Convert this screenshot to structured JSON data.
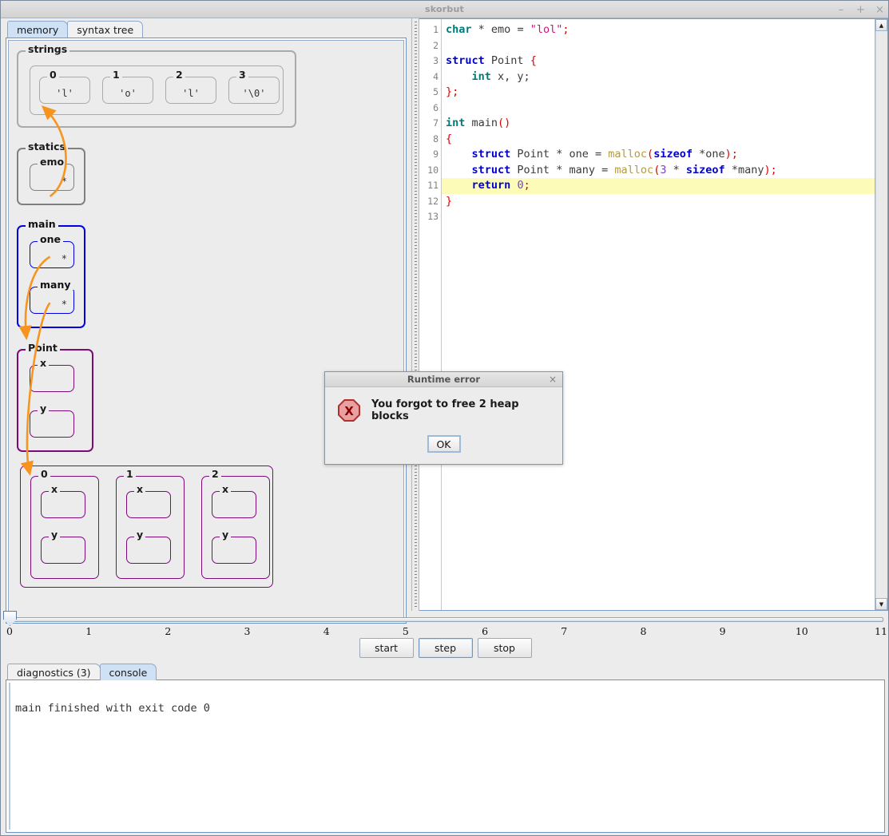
{
  "window": {
    "title": "skorbut",
    "controls": [
      {
        "name": "minimize",
        "glyph": "–"
      },
      {
        "name": "maximize",
        "glyph": "+"
      },
      {
        "name": "close",
        "glyph": "×"
      }
    ]
  },
  "left_tabs": [
    {
      "label": "memory",
      "selected": true
    },
    {
      "label": "syntax tree",
      "selected": false
    }
  ],
  "memory": {
    "strings": {
      "label": "strings",
      "block_label": "",
      "cells": [
        {
          "index": "0",
          "value": "'l'"
        },
        {
          "index": "1",
          "value": "'o'"
        },
        {
          "index": "2",
          "value": "'l'"
        },
        {
          "index": "3",
          "value": "'\\0'"
        }
      ]
    },
    "statics": {
      "label": "statics",
      "vars": [
        {
          "name": "emo",
          "value": "*"
        }
      ]
    },
    "main": {
      "label": "main",
      "vars": [
        {
          "name": "one",
          "value": "*"
        },
        {
          "name": "many",
          "value": "*"
        }
      ]
    },
    "point": {
      "label": "Point",
      "fields": [
        {
          "name": "x",
          "value": ""
        },
        {
          "name": "y",
          "value": ""
        }
      ]
    },
    "heap_array": {
      "elements": [
        {
          "index": "0",
          "fields": [
            {
              "name": "x",
              "value": ""
            },
            {
              "name": "y",
              "value": ""
            }
          ]
        },
        {
          "index": "1",
          "fields": [
            {
              "name": "x",
              "value": ""
            },
            {
              "name": "y",
              "value": ""
            }
          ]
        },
        {
          "index": "2",
          "fields": [
            {
              "name": "x",
              "value": ""
            },
            {
              "name": "y",
              "value": ""
            }
          ]
        }
      ]
    },
    "pointer_color": "#F7941E"
  },
  "editor": {
    "highlighted_line": 11,
    "lines": [
      {
        "n": 1,
        "tokens": [
          {
            "t": "char",
            "c": "ty"
          },
          {
            "t": " ",
            "c": "op"
          },
          {
            "t": "*",
            "c": "op"
          },
          {
            "t": " emo ",
            "c": "id"
          },
          {
            "t": "=",
            "c": "op"
          },
          {
            "t": " ",
            "c": "id"
          },
          {
            "t": "\"lol\"",
            "c": "str"
          },
          {
            "t": ";",
            "c": "punc"
          }
        ]
      },
      {
        "n": 2,
        "tokens": []
      },
      {
        "n": 3,
        "tokens": [
          {
            "t": "struct",
            "c": "k"
          },
          {
            "t": " Point ",
            "c": "id"
          },
          {
            "t": "{",
            "c": "punc"
          }
        ]
      },
      {
        "n": 4,
        "tokens": [
          {
            "t": "    ",
            "c": "id"
          },
          {
            "t": "int",
            "c": "ty"
          },
          {
            "t": " x, y;",
            "c": "id"
          }
        ]
      },
      {
        "n": 5,
        "tokens": [
          {
            "t": "}",
            "c": "punc"
          },
          {
            "t": ";",
            "c": "punc"
          }
        ]
      },
      {
        "n": 6,
        "tokens": []
      },
      {
        "n": 7,
        "tokens": [
          {
            "t": "int",
            "c": "ty"
          },
          {
            "t": " main",
            "c": "id"
          },
          {
            "t": "()",
            "c": "punc"
          }
        ]
      },
      {
        "n": 8,
        "tokens": [
          {
            "t": "{",
            "c": "punc"
          }
        ]
      },
      {
        "n": 9,
        "tokens": [
          {
            "t": "    ",
            "c": "id"
          },
          {
            "t": "struct",
            "c": "k"
          },
          {
            "t": " Point ",
            "c": "id"
          },
          {
            "t": "*",
            "c": "op"
          },
          {
            "t": " one ",
            "c": "id"
          },
          {
            "t": "=",
            "c": "op"
          },
          {
            "t": " ",
            "c": "id"
          },
          {
            "t": "malloc",
            "c": "fn"
          },
          {
            "t": "(",
            "c": "punc"
          },
          {
            "t": "sizeof",
            "c": "k"
          },
          {
            "t": " ",
            "c": "id"
          },
          {
            "t": "*",
            "c": "op"
          },
          {
            "t": "one",
            "c": "id"
          },
          {
            "t": ")",
            "c": "punc"
          },
          {
            "t": ";",
            "c": "punc"
          }
        ]
      },
      {
        "n": 10,
        "tokens": [
          {
            "t": "    ",
            "c": "id"
          },
          {
            "t": "struct",
            "c": "k"
          },
          {
            "t": " Point ",
            "c": "id"
          },
          {
            "t": "*",
            "c": "op"
          },
          {
            "t": " many ",
            "c": "id"
          },
          {
            "t": "=",
            "c": "op"
          },
          {
            "t": " ",
            "c": "id"
          },
          {
            "t": "malloc",
            "c": "fn"
          },
          {
            "t": "(",
            "c": "punc"
          },
          {
            "t": "3",
            "c": "num"
          },
          {
            "t": " ",
            "c": "id"
          },
          {
            "t": "*",
            "c": "op"
          },
          {
            "t": " ",
            "c": "id"
          },
          {
            "t": "sizeof",
            "c": "k"
          },
          {
            "t": " ",
            "c": "id"
          },
          {
            "t": "*",
            "c": "op"
          },
          {
            "t": "many",
            "c": "id"
          },
          {
            "t": ")",
            "c": "punc"
          },
          {
            "t": ";",
            "c": "punc"
          }
        ]
      },
      {
        "n": 11,
        "tokens": [
          {
            "t": "    ",
            "c": "id"
          },
          {
            "t": "return",
            "c": "k"
          },
          {
            "t": " ",
            "c": "id"
          },
          {
            "t": "0",
            "c": "num"
          },
          {
            "t": ";",
            "c": "punc"
          }
        ]
      },
      {
        "n": 12,
        "tokens": [
          {
            "t": "}",
            "c": "punc"
          }
        ]
      },
      {
        "n": 13,
        "tokens": []
      }
    ]
  },
  "scrollbar": {
    "up": "▲",
    "down": "▼"
  },
  "slider": {
    "value": 0,
    "min": 0,
    "max": 11,
    "ticks": [
      "0",
      "1",
      "2",
      "3",
      "4",
      "5",
      "6",
      "7",
      "8",
      "9",
      "10",
      "11"
    ]
  },
  "controls": [
    {
      "label": "start",
      "focused": false
    },
    {
      "label": "step",
      "focused": true
    },
    {
      "label": "stop",
      "focused": false
    }
  ],
  "bottom_tabs": [
    {
      "label": "diagnostics (3)",
      "selected": false
    },
    {
      "label": "console",
      "selected": true
    }
  ],
  "console": {
    "text": "main finished with exit code 0"
  },
  "dialog": {
    "title": "Runtime error",
    "close_glyph": "×",
    "message": "You forgot to free 2 heap blocks",
    "icon_letter": "X",
    "icon_color": "#E8A0A0",
    "icon_border": "#B03030",
    "button": "OK"
  }
}
